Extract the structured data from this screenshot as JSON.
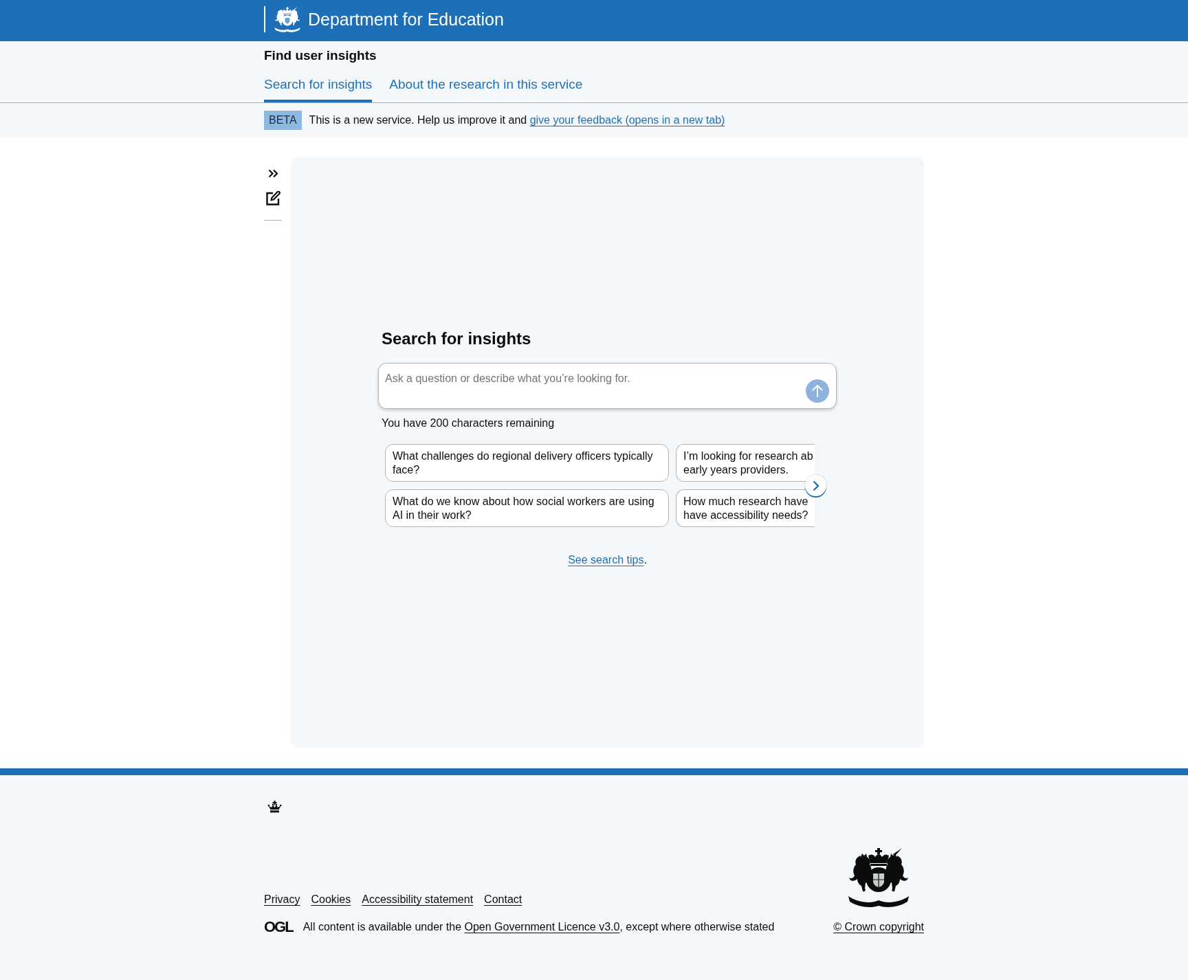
{
  "header": {
    "organisation": "Department for Education"
  },
  "service_navigation": {
    "service_name": "Find user insights",
    "tabs": [
      {
        "label": "Search for insights",
        "selected": true
      },
      {
        "label": "About the research in this service",
        "selected": false
      }
    ]
  },
  "phase_banner": {
    "tag": "BETA",
    "text": "This is a new service. Help us improve it and",
    "link": "give your feedback (opens in a new tab)"
  },
  "search": {
    "heading": "Search for insights",
    "placeholder": "Ask a question or describe what you’re looking for.",
    "submit_disabled": true,
    "characters_remaining": "You have 200 characters remaining",
    "suggestions": [
      {
        "text": "What challenges do regional delivery officers typically face?",
        "clipped": false
      },
      {
        "text": "I’m looking for research ab\nearly years providers.",
        "clipped": true
      },
      {
        "text": "What do we know about how social workers are using AI in their work?",
        "clipped": false
      },
      {
        "text": "How much research have\nhave accessibility needs?",
        "clipped": true
      }
    ],
    "tips": {
      "link": "See search tips",
      "after": "."
    }
  },
  "footer": {
    "links": [
      "Privacy",
      "Cookies",
      "Accessibility statement",
      "Contact"
    ],
    "licence": {
      "logo": "OGL",
      "before": "All content is available under the",
      "link": "Open Government Licence v3.0",
      "after": ", except where otherwise stated"
    },
    "copyright": "© Crown copyright"
  }
}
